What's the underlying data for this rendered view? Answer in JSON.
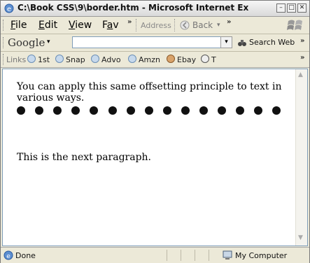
{
  "window": {
    "title": "C:\\Book CSS\\9\\border.htm - Microsoft Internet Ex...",
    "buttons": {
      "minimize": "–",
      "maximize": "□",
      "close": "✕"
    }
  },
  "menu": {
    "items": [
      {
        "label": "File"
      },
      {
        "label": "Edit"
      },
      {
        "label": "View"
      },
      {
        "label": "Fav"
      }
    ],
    "more": "»",
    "address_label": "Address",
    "back_label": "Back"
  },
  "googlebar": {
    "logo": "Google",
    "search_value": "",
    "search_web_label": "Search Web",
    "more": "»"
  },
  "links": {
    "label": "Links",
    "items": [
      {
        "label": "1st"
      },
      {
        "label": "Snap"
      },
      {
        "label": "Advo"
      },
      {
        "label": "Amzn"
      },
      {
        "label": "Ebay"
      },
      {
        "label": "T"
      }
    ],
    "more": "»"
  },
  "page": {
    "paragraph1": "You can apply this same offsetting principle to text in various ways.",
    "dot_count": 15,
    "paragraph2": "This is the next paragraph."
  },
  "status": {
    "text": "Done",
    "zone": "My Computer"
  }
}
